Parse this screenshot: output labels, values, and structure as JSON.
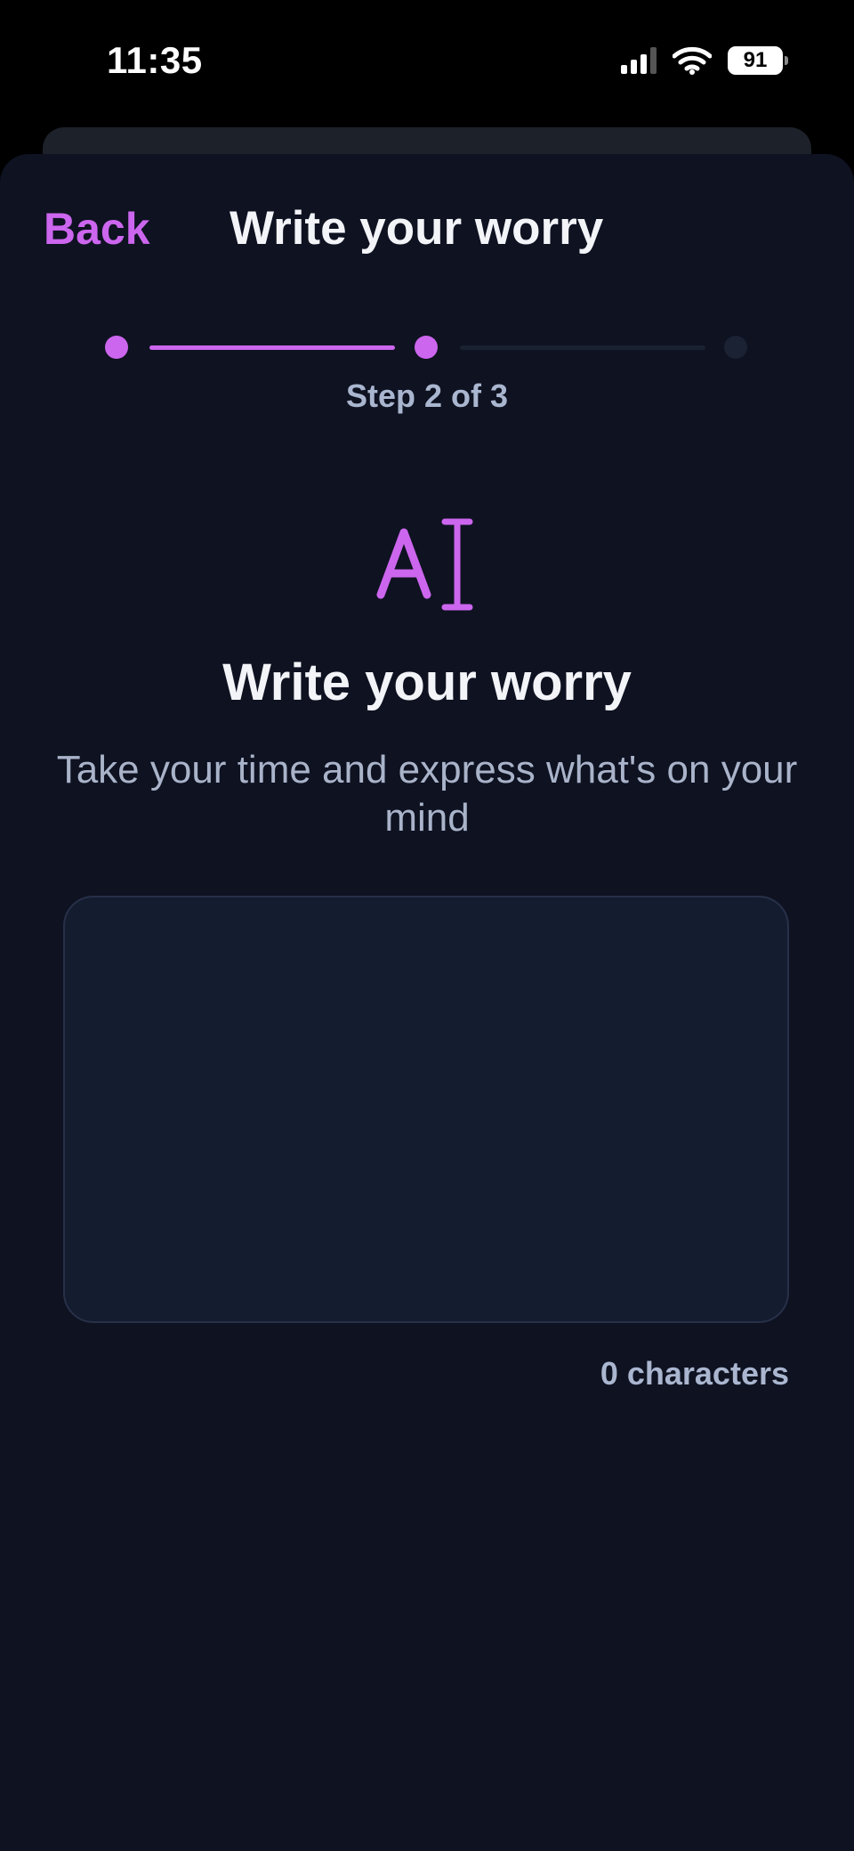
{
  "status_bar": {
    "time": "11:35",
    "battery": "91",
    "signal_icon": "cellular-signal-icon",
    "wifi_icon": "wifi-icon",
    "battery_icon": "battery-icon"
  },
  "nav": {
    "back_label": "Back",
    "title": "Write your worry"
  },
  "progress": {
    "current_step": 2,
    "total_steps": 3,
    "label": "Step 2 of 3"
  },
  "content": {
    "icon": "text-cursor-icon",
    "heading": "Write your worry",
    "subtitle": "Take your time and express what's on your mind"
  },
  "input": {
    "value": "",
    "placeholder": ""
  },
  "char_count": "0 characters",
  "colors": {
    "accent": "#cc66ee",
    "background": "#0e1221",
    "input_background": "#141d30",
    "inactive_step": "#1b2234"
  }
}
